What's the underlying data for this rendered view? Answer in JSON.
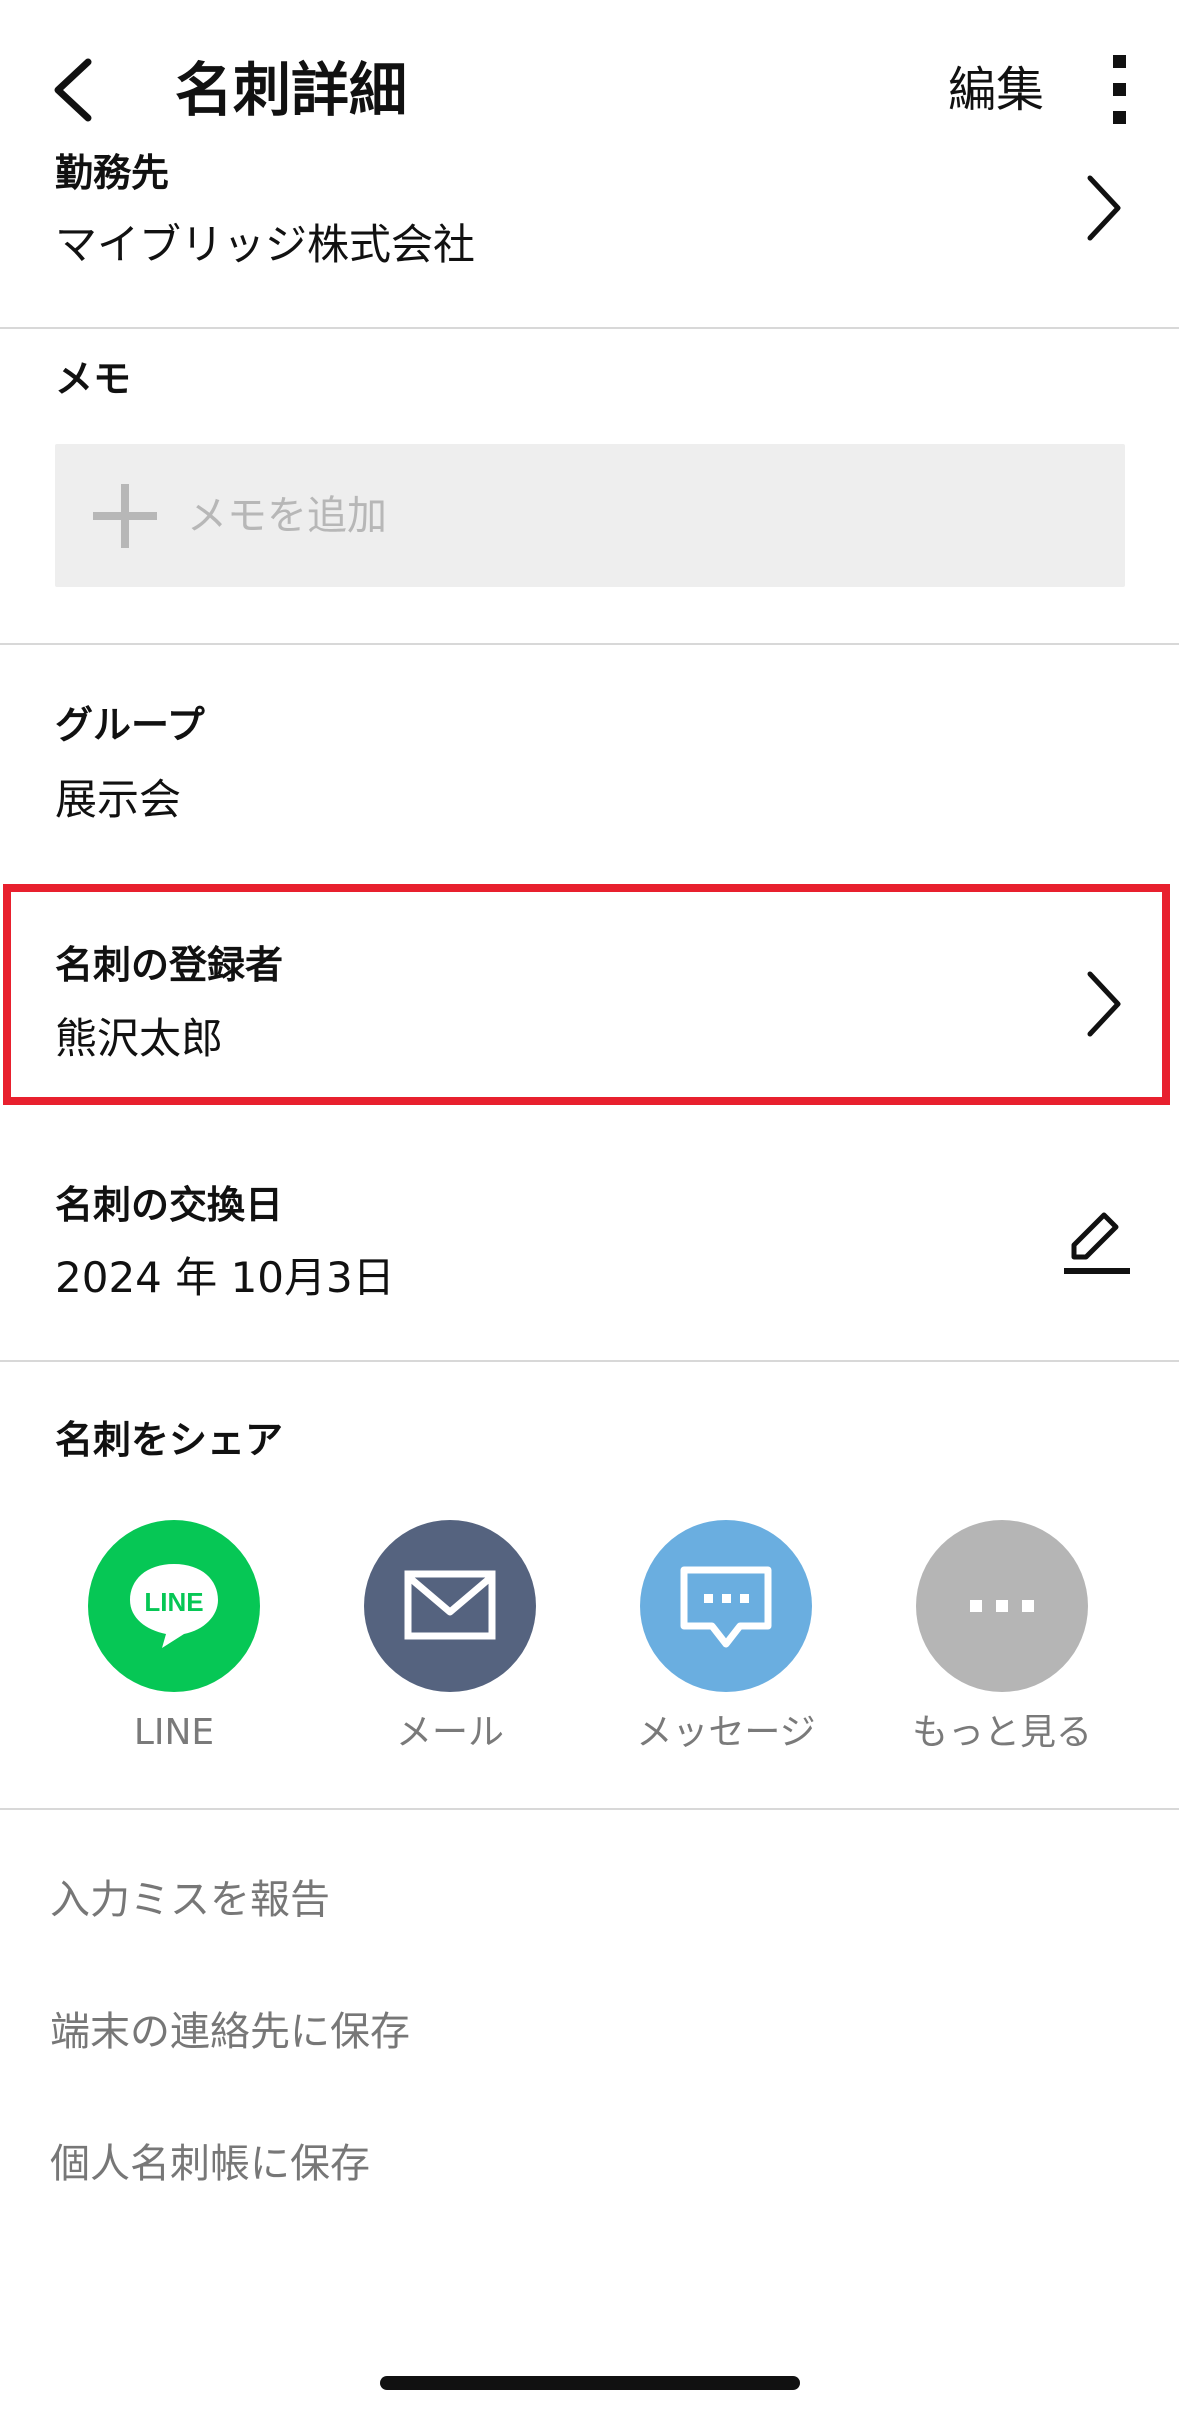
{
  "header": {
    "title": "名刺詳細",
    "edit_label": "編集",
    "back_icon": "chevron-left-icon",
    "more_icon": "vertical-ellipsis-icon"
  },
  "company": {
    "label": "勤務先",
    "value": "マイブリッジ株式会社"
  },
  "memo": {
    "label": "メモ",
    "placeholder": "メモを追加"
  },
  "group": {
    "label": "グループ",
    "value": "展示会"
  },
  "registrant": {
    "label": "名刺の登録者",
    "value": "熊沢太郎"
  },
  "exchange_date": {
    "label": "名刺の交換日",
    "value": "2024 年 10月3日"
  },
  "share": {
    "label": "名刺をシェア",
    "items": [
      {
        "label": "LINE",
        "icon": "line-icon",
        "color": "#06c755",
        "badge_text": "LINE"
      },
      {
        "label": "メール",
        "icon": "mail-icon",
        "color": "#55637f"
      },
      {
        "label": "メッセージ",
        "icon": "message-icon",
        "color": "#6aaee0"
      },
      {
        "label": "もっと見る",
        "icon": "more-horizontal-icon",
        "color": "#b5b5b5"
      }
    ]
  },
  "links": [
    {
      "label": "入力ミスを報告"
    },
    {
      "label": "端末の連絡先に保存"
    },
    {
      "label": "個人名刺帳に保存"
    }
  ],
  "colors": {
    "highlight": "#e8202e",
    "divider": "#d8d8d8"
  }
}
